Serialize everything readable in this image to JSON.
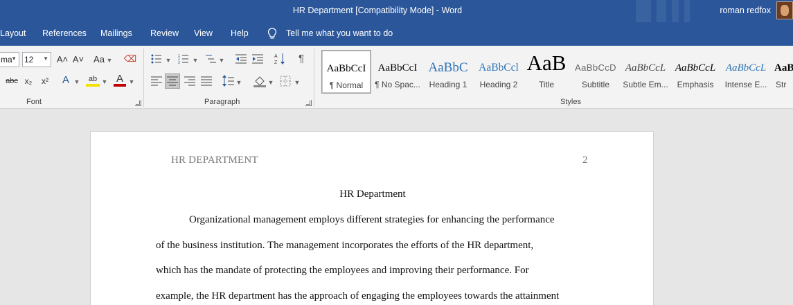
{
  "window": {
    "title": "HR Department [Compatibility Mode]  -  Word",
    "user": "roman redfox"
  },
  "menu": {
    "tabs": [
      "Layout",
      "References",
      "Mailings",
      "Review",
      "View",
      "Help"
    ],
    "tell_me": "Tell me what you want to do"
  },
  "ribbon": {
    "font": {
      "name": "ma",
      "size": "12",
      "grow": "A˄",
      "shrink": "A˅",
      "change_case": "Aa",
      "strikethrough": "abc",
      "subscript": "x₂",
      "superscript": "x²",
      "text_effects": "A",
      "highlight": "ab",
      "font_color": "A",
      "label": "Font"
    },
    "paragraph": {
      "label": "Paragraph",
      "pilcrow": "¶"
    },
    "styles": {
      "label": "Styles",
      "items": [
        {
          "sample": "AaBbCcI",
          "name": "¶ Normal"
        },
        {
          "sample": "AaBbCcI",
          "name": "¶ No Spac..."
        },
        {
          "sample": "AaBbC",
          "name": "Heading 1"
        },
        {
          "sample": "AaBbCcl",
          "name": "Heading 2"
        },
        {
          "sample": "AaB",
          "name": "Title"
        },
        {
          "sample": "AaBbCcD",
          "name": "Subtitle"
        },
        {
          "sample": "AaBbCcL",
          "name": "Subtle Em..."
        },
        {
          "sample": "AaBbCcL",
          "name": "Emphasis"
        },
        {
          "sample": "AaBbCcL",
          "name": "Intense E..."
        },
        {
          "sample": "AaB",
          "name": "Str"
        }
      ]
    }
  },
  "document": {
    "running_head": "HR DEPARTMENT",
    "page_number": "2",
    "title": "HR Department",
    "lines": [
      "Organizational management employs different strategies for enhancing the performance",
      "of the business institution. The management incorporates the efforts of the HR department,",
      "which has the mandate of protecting the employees and improving their performance. For",
      "example, the HR department has the approach of engaging the employees towards the attainment"
    ]
  },
  "colors": {
    "brand": "#2b579a",
    "ribbon_bg": "#f3f3f3",
    "canvas_bg": "#e6e6e6"
  }
}
